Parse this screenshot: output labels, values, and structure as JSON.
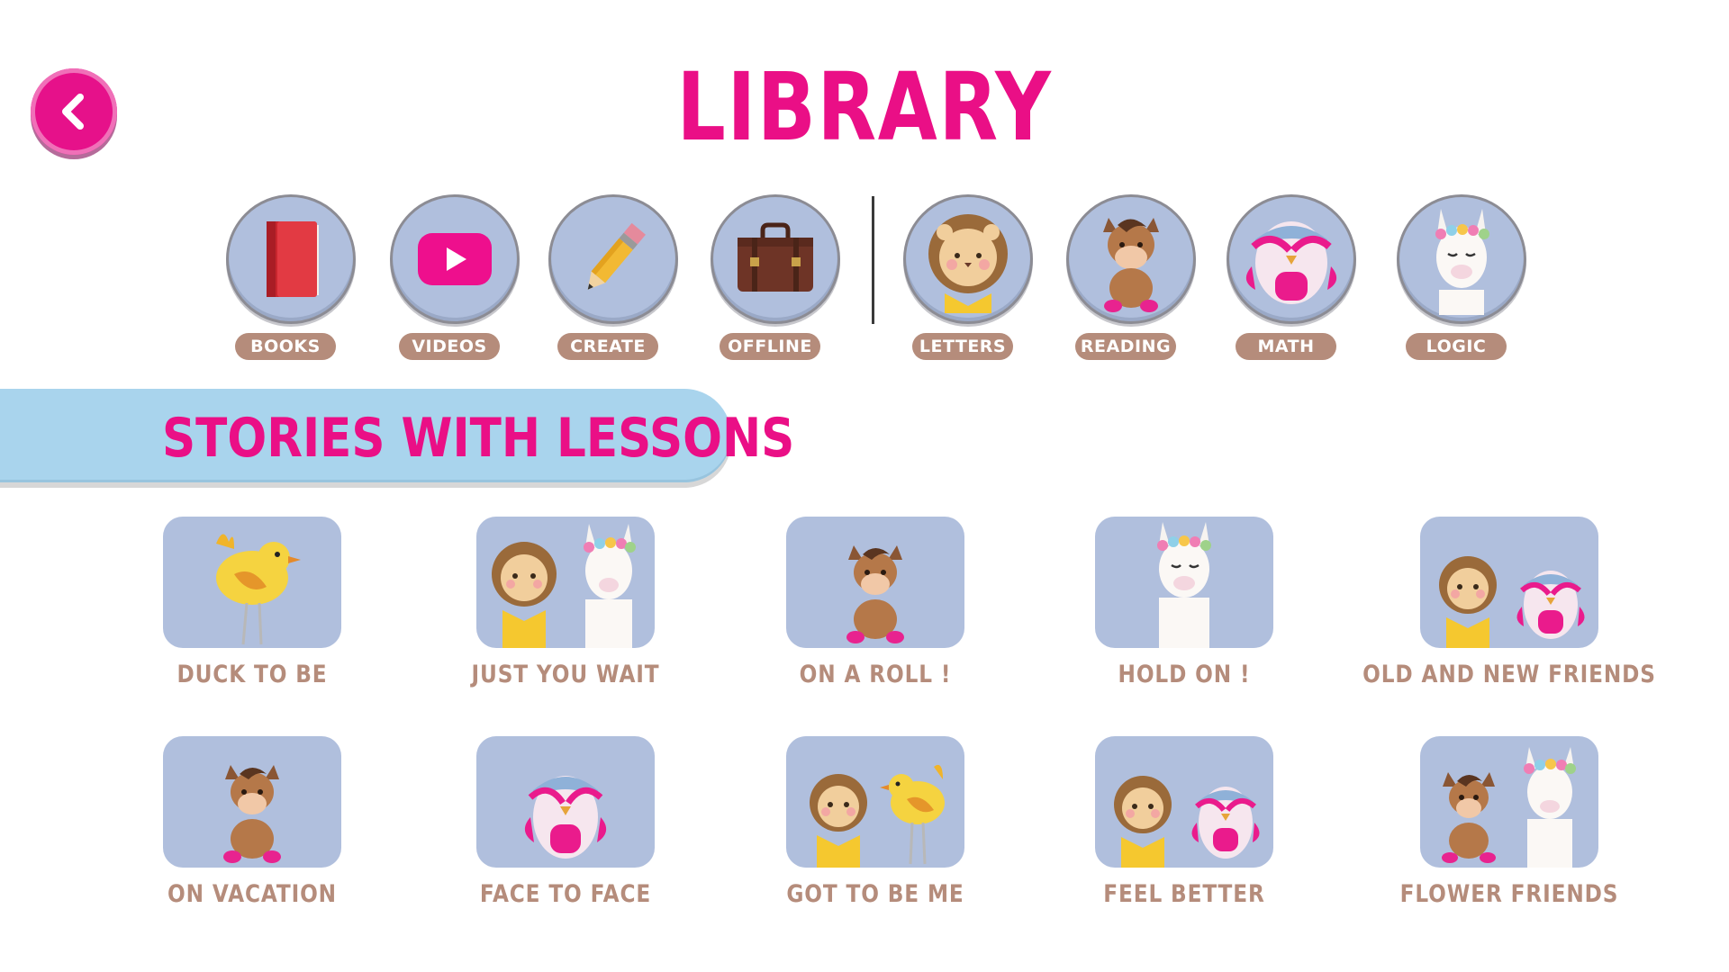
{
  "header": {
    "title": "LIBRARY",
    "back_icon": "chevron-left-icon"
  },
  "nav": {
    "items": [
      {
        "label": "BOOKS",
        "icon": "book-icon"
      },
      {
        "label": "VIDEOS",
        "icon": "play-icon"
      },
      {
        "label": "CREATE",
        "icon": "pencil-icon"
      },
      {
        "label": "OFFLINE",
        "icon": "suitcase-icon"
      },
      {
        "label": "LETTERS",
        "icon": "lion-icon"
      },
      {
        "label": "READING",
        "icon": "pony-icon"
      },
      {
        "label": "MATH",
        "icon": "owl-icon"
      },
      {
        "label": "LOGIC",
        "icon": "llama-icon"
      }
    ]
  },
  "section": {
    "title": "STORIES WITH LESSONS"
  },
  "stories": [
    {
      "label": "DUCK TO BE",
      "characters": [
        "bird"
      ]
    },
    {
      "label": "JUST YOU WAIT",
      "characters": [
        "lion",
        "llama"
      ]
    },
    {
      "label": "ON A ROLL !",
      "characters": [
        "pony"
      ]
    },
    {
      "label": "HOLD ON !",
      "characters": [
        "llama"
      ]
    },
    {
      "label": "OLD AND NEW FRIENDS",
      "characters": [
        "lion",
        "owl"
      ]
    },
    {
      "label": "ON VACATION",
      "characters": [
        "pony"
      ]
    },
    {
      "label": "FACE TO FACE",
      "characters": [
        "owl"
      ]
    },
    {
      "label": "GOT TO BE ME",
      "characters": [
        "lion",
        "bird"
      ]
    },
    {
      "label": "FEEL BETTER",
      "characters": [
        "lion",
        "owl"
      ]
    },
    {
      "label": "FLOWER FRIENDS",
      "characters": [
        "pony",
        "llama"
      ]
    }
  ],
  "colors": {
    "accent": "#ea0f86",
    "tile": "#b0bfdd",
    "label": "#b58c7b",
    "banner": "#a9d4ed"
  }
}
